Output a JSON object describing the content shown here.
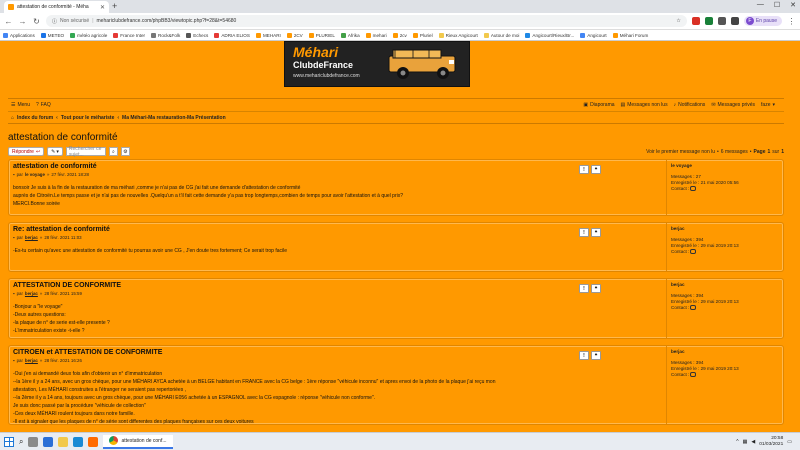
{
  "browser": {
    "tab_title": "attestation de conformité - Méha",
    "address_security": "Non sécurisé",
    "address_url": "mehariclubdefrance.com/phpBB3/viewtopic.php?f=28&t=54680",
    "profile_label": "En pause",
    "bookmarks": [
      "Applications",
      "METEO",
      "météo agricole",
      "France Inter",
      "Rock&Folk",
      "Echecs",
      "ADRIA ELIOS",
      "MEHARI",
      "2CV",
      "PLURIEL",
      "Afrika",
      "mehari",
      "2cv",
      "Pluriel",
      "Rieux Angicourt",
      "Autour de moi",
      "Angicourt/Rieux/Br...",
      "Angicourt",
      "Méhari Forum"
    ]
  },
  "logo": {
    "title": "Méhari",
    "subtitle": "ClubdeFrance",
    "url": "www.mehariclubdefrance.com"
  },
  "nav": {
    "menu": "Menu",
    "faq": "FAQ",
    "diaporama": "Diaporama",
    "unread": "Messages non lus",
    "notifications": "Notifications",
    "private_messages": "Messages privés",
    "username": "faze",
    "breadcrumb": [
      "Index du forum",
      "Tout pour le méhariste",
      "Ma Méhari-Ma restauration-Ma Présentation"
    ]
  },
  "topic": {
    "title": "attestation de conformité",
    "reply_label": "Répondre",
    "search_placeholder": "Rechercher ce sujet...",
    "first_unread": "Voir le premier message non lu",
    "count": "6 messages",
    "page_label": "Page",
    "page_current": "1",
    "page_sep": "sur",
    "page_total": "1"
  },
  "posts": [
    {
      "title": "attestation de conformité",
      "by": "par",
      "author": "le voyage",
      "date": "27 févr. 2021 18:28",
      "lines": [
        "bonsoir Je suis à la fin de la restauration de ma méhari ,comme je n'ai pas de CG j'ai fait une demande d'attestation de conformité",
        "auprès de Citroën.Le temps passe et je n'ai pas de nouvelles .Quelqu'un a t'il fait cette demande y'a pas trop longtemps,combien de temps pour avoir l'attestation et à quel prix?",
        "MERCI.Bonne soirée"
      ],
      "profile_name": "le voyage",
      "messages": "Messages : 27",
      "registered": "Enregistré le : 21 mai 2020 05:56",
      "contact": "Contact :"
    },
    {
      "title": "Re: attestation de conformité",
      "by": "par",
      "author": "berjac",
      "date": "28 févr. 2021 11:03",
      "lines": [
        "-Es-tu certain qu'avec une attestation de conformité tu pourras avoir une CG , J'en doute tres fortement; Ce serait trop facile"
      ],
      "profile_name": "berjac",
      "messages": "Messages : 394",
      "registered": "Enregistré le : 29 mai 2019 20:13",
      "contact": "Contact :"
    },
    {
      "title": "ATTESTATION DE CONFORMITE",
      "by": "par",
      "author": "berjac",
      "date": "28 févr. 2021 15:59",
      "lines": [
        "-Bonjour a \"le voyage\"",
        "-Deux autres questions:",
        "-la plaque de n° de serie est-elle presente ?",
        "-L'immatriculation existe -t-elle ?"
      ],
      "profile_name": "berjac",
      "messages": "Messages : 394",
      "registered": "Enregistré le : 29 mai 2019 20:13",
      "contact": "Contact :"
    },
    {
      "title": "CITROEN et ATTESTATION DE CONFORMITE",
      "by": "par",
      "author": "berjac",
      "date": "28 févr. 2021 16:26",
      "lines": [
        "-Oui j'en ai demandé deux fois afin d'obtenir un n° d'immatriculation",
        "--la 1ère il y a 24 ans, avec un gros chèque, pour une MÉHARI AYCA achetée à un BELGE habitant en FRANCE avec la CG belge : 1ère réponse \"véhicule inconnu\" et apres envoi de la photo de la plaque j'ai reçu mon",
        "attestation, Les MÉHARI construites a l'étranger ne seraient pas repertoriées ,",
        "--la 2ème il y a 14 ans, toujours avec un gros chèque, pour une MÉHARI E056 achetée à un ESPAGNOL avec la CG espagnole : réponse \"véhicule non conforme\".",
        "Je suis donc passé par la procédure \"véhicule de collection\"",
        "-Ces deux MÉHARI roulent toujours dans notre famille.",
        "-Il est à signaler que les plaques de n° de série sont differentes des plaques françaises sur ces deux voitures"
      ],
      "profile_name": "berjac",
      "messages": "Messages : 394",
      "registered": "Enregistré le : 29 mai 2019 20:13",
      "contact": "Contact :"
    }
  ],
  "taskbar": {
    "task_label": "attestation de conf...",
    "time": "20:58",
    "date": "01/03/2021"
  },
  "colors": {
    "forum_orange": "#ff9900",
    "border_orange": "#e08600",
    "reply_red": "#bb0000"
  }
}
